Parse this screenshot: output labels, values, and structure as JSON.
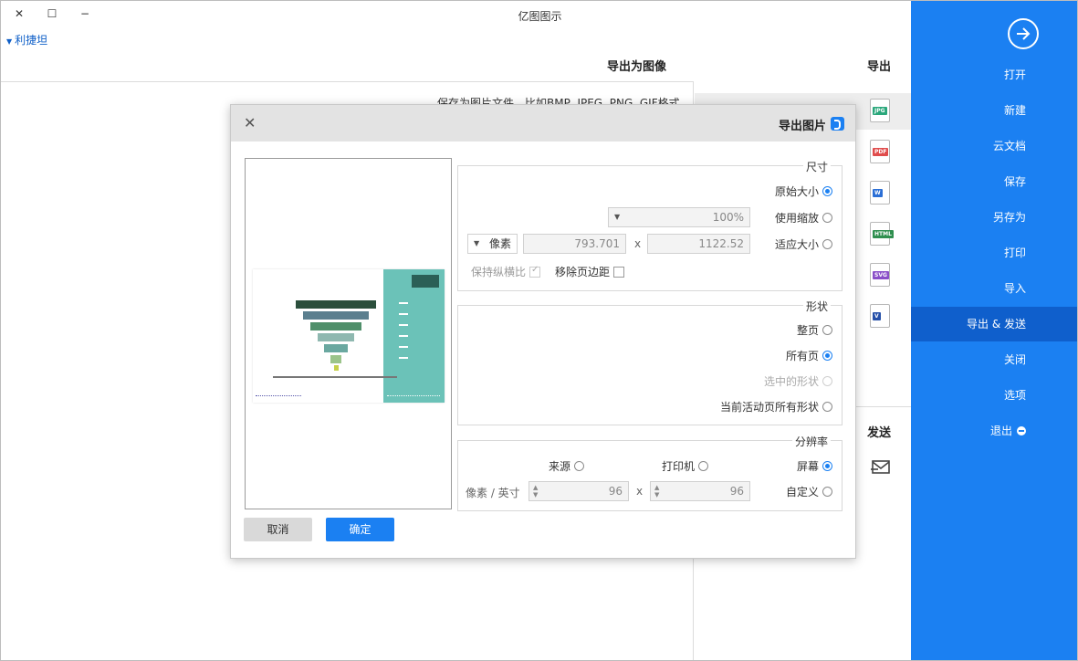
{
  "window": {
    "title": "亿图图示",
    "close_symbol": "✕",
    "maximize_symbol": "☐",
    "minimize_symbol": "−",
    "user_label": "利捷坦"
  },
  "sidebar": {
    "items": [
      {
        "label": "打开"
      },
      {
        "label": "新建"
      },
      {
        "label": "云文档"
      },
      {
        "label": "保存"
      },
      {
        "label": "另存为"
      },
      {
        "label": "打印"
      },
      {
        "label": "导入"
      },
      {
        "label": "导出 & 发送",
        "active": true
      },
      {
        "label": "关闭"
      },
      {
        "label": "选项"
      },
      {
        "label": "退出"
      }
    ],
    "accent": "#1b80f2",
    "active_bg": "#0f5fcc"
  },
  "export_panel": {
    "header": "导出",
    "formats": [
      {
        "icon": "jpg-file-icon",
        "badge": "JPG",
        "color": "#2aa77b",
        "active": true
      },
      {
        "icon": "pdf-file-icon",
        "badge": "PDF",
        "color": "#e04c4c"
      },
      {
        "icon": "word-file-icon",
        "badge": "W",
        "color": "#2b6fd6"
      },
      {
        "icon": "html-file-icon",
        "badge": "HTML",
        "color": "#2f8f4f"
      },
      {
        "icon": "svg-file-icon",
        "badge": "SVG",
        "color": "#8a4fc8"
      },
      {
        "icon": "visio-file-icon",
        "badge": "V",
        "color": "#2650a8"
      }
    ],
    "send_header": "发送"
  },
  "content": {
    "header": "导出为图像",
    "description": "保存为图片文件，比如BMP, JPEG, PNG, GIF格式"
  },
  "dialog": {
    "title": "导出图片",
    "close_symbol": "✕",
    "size_group": {
      "title": "尺寸",
      "opt_original": "原始大小",
      "opt_zoom": "使用缩放",
      "zoom_value": "100%",
      "opt_fit": "适应大小",
      "width": "1122.52",
      "height": "793.701",
      "unit": "像素",
      "times": "x",
      "remove_margin_label": "移除页边距",
      "keep_ratio_label": "保持纵横比"
    },
    "shape_group": {
      "title": "形状",
      "opt_whole_page": "整页",
      "opt_all_pages": "所有页",
      "opt_selected": "选中的形状",
      "opt_current_page_shapes": "当前活动页所有形状"
    },
    "resolution_group": {
      "title": "分辨率",
      "opt_screen": "屏幕",
      "opt_printer": "打印机",
      "opt_source": "来源",
      "opt_custom": "自定义",
      "dpi_x": "96",
      "dpi_y": "96",
      "times": "x",
      "unit": "像素 / 英寸"
    },
    "ok_label": "确定",
    "cancel_label": "取消"
  }
}
